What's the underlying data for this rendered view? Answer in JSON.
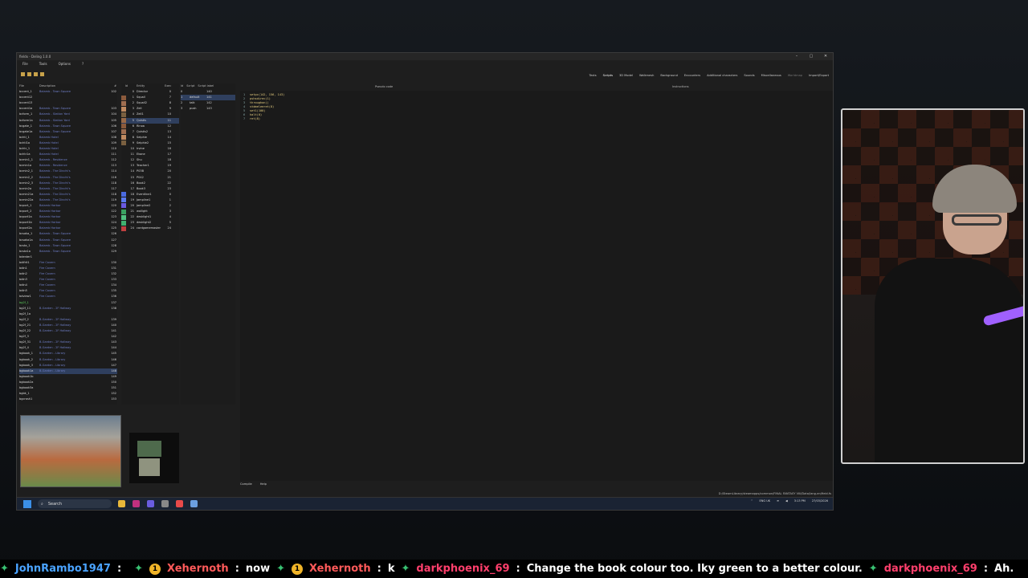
{
  "window": {
    "title": "fieldx - Deling 1.0.0",
    "controls": [
      "–",
      "▢",
      "✕"
    ]
  },
  "menu": [
    "File",
    "Tools",
    "Options",
    "?"
  ],
  "tabs": [
    {
      "label": "Texts"
    },
    {
      "label": "Scripts",
      "active": true
    },
    {
      "label": "3D Model"
    },
    {
      "label": "Walkmesh"
    },
    {
      "label": "Background"
    },
    {
      "label": "Encounters"
    },
    {
      "label": "Additional characters"
    },
    {
      "label": "Sounds"
    },
    {
      "label": "Miscellaneous"
    },
    {
      "label": "Worldmap",
      "dim": true
    },
    {
      "label": "Import/Export"
    }
  ],
  "file_list": {
    "headers": [
      "File",
      "Description",
      "#"
    ],
    "rows": [
      [
        "bccent_1",
        "Balamb - Town Square",
        "102"
      ],
      [
        "bccent12",
        "",
        ""
      ],
      [
        "bccent13",
        "",
        ""
      ],
      [
        "bccent1a",
        "Balamb - Town Square",
        "103"
      ],
      [
        "bcform_1",
        "Balamb - Station Yard",
        "104"
      ],
      [
        "bcform1a",
        "Balamb - Station Yard",
        "105"
      ],
      [
        "bcgate_1",
        "Balamb - Town Square",
        "106"
      ],
      [
        "bcgate1a",
        "Balamb - Town Square",
        "107"
      ],
      [
        "bchtl_1",
        "Balamb Hotel",
        "108"
      ],
      [
        "bchtl1a",
        "Balamb Hotel",
        "109"
      ],
      [
        "bchtr_1",
        "Balamb Hotel",
        "110"
      ],
      [
        "bchtr1a",
        "Balamb Hotel",
        "111"
      ],
      [
        "bcmin1_1",
        "Balamb - Residence",
        "112"
      ],
      [
        "bcmin1a",
        "Balamb - Residence",
        "113"
      ],
      [
        "bcmin2_1",
        "Balamb - The Dincht's",
        "114"
      ],
      [
        "bcmin2_2",
        "Balamb - The Dincht's",
        "116"
      ],
      [
        "bcmin2_3",
        "Balamb - The Dincht's",
        "118"
      ],
      [
        "bcmin2a",
        "Balamb - The Dincht's",
        "117"
      ],
      [
        "bcmin21a",
        "Balamb - The Dincht's",
        "118"
      ],
      [
        "bcmin22a",
        "Balamb - The Dincht's",
        "119"
      ],
      [
        "bcport_1",
        "Balamb Harbor",
        "120"
      ],
      [
        "bcport_2",
        "Balamb Harbor",
        "122"
      ],
      [
        "bcport1a",
        "Balamb Harbor",
        "123"
      ],
      [
        "bcport1b",
        "Balamb Harbor",
        "124"
      ],
      [
        "bcport2a",
        "Balamb Harbor",
        "125"
      ],
      [
        "bcsaka_1",
        "Balamb - Town Square",
        "126"
      ],
      [
        "bcsaka1a",
        "Balamb - Town Square",
        "127"
      ],
      [
        "bcsta_1",
        "Balamb - Town Square",
        "128"
      ],
      [
        "bcsta1a",
        "Balamb - Town Square",
        "129"
      ],
      [
        "bdenter1",
        "",
        ""
      ],
      [
        "bdifrit1",
        "Fire Cavern",
        "130"
      ],
      [
        "bdin1",
        "Fire Cavern",
        "131"
      ],
      [
        "bdin2",
        "Fire Cavern",
        "132"
      ],
      [
        "bdin3",
        "Fire Cavern",
        "133"
      ],
      [
        "bdin4",
        "Fire Cavern",
        "134"
      ],
      [
        "bdin5",
        "Fire Cavern",
        "135"
      ],
      [
        "bdview1",
        "Fire Cavern",
        "136"
      ],
      [
        "bg2f_1",
        "",
        "137"
      ],
      [
        "bg2f_11",
        "B-Garden - 2F Hallway",
        "138"
      ],
      [
        "bg2f_1a",
        "",
        ""
      ],
      [
        "bg2f_2",
        "B-Garden - 2F Hallway",
        "139"
      ],
      [
        "bg2f_21",
        "B-Garden - 2F Hallway",
        "140"
      ],
      [
        "bg2f_22",
        "B-Garden - 2F Hallway",
        "141"
      ],
      [
        "bg2f_3",
        "",
        "142"
      ],
      [
        "bg2f_31",
        "B-Garden - 2F Hallway",
        "143"
      ],
      [
        "bg2f_4",
        "B-Garden - 2F Hallway",
        "144"
      ],
      [
        "bgbook_1",
        "B-Garden - Library",
        "145"
      ],
      [
        "bgbook_2",
        "B-Garden - Library",
        "146"
      ],
      [
        "bgbook_3",
        "B-Garden - Library",
        "147"
      ],
      [
        "bgbook1a",
        "B-Garden - Library",
        "148"
      ],
      [
        "bgbook1b",
        "",
        "149"
      ],
      [
        "bgbook2a",
        "",
        "150"
      ],
      [
        "bgbook3a",
        "",
        "151"
      ],
      [
        "bgbk_1",
        "",
        "152"
      ],
      [
        "bgcrash1",
        "",
        "153"
      ]
    ]
  },
  "entities": {
    "headers": [
      "Id",
      "Entity",
      "Exec"
    ],
    "rows": [
      [
        "0",
        "Director",
        "0"
      ],
      [
        "1",
        "Squall",
        "7"
      ],
      [
        "2",
        "Squall2",
        "8"
      ],
      [
        "3",
        "Zell",
        "9"
      ],
      [
        "4",
        "Zell1",
        "10"
      ],
      [
        "5",
        "Quistis",
        "11"
      ],
      [
        "6",
        "Rinoa",
        "12"
      ],
      [
        "7",
        "Quistis2",
        "13"
      ],
      [
        "8",
        "Selphie",
        "14"
      ],
      [
        "9",
        "Selphie2",
        "15"
      ],
      [
        "10",
        "Irvine",
        "16"
      ],
      [
        "11",
        "Ekone",
        "17"
      ],
      [
        "12",
        "Shu",
        "18"
      ],
      [
        "13",
        "Teacher1",
        "19"
      ],
      [
        "14",
        "P03B",
        "20"
      ],
      [
        "15",
        "P042",
        "21"
      ],
      [
        "16",
        "Book2",
        "22"
      ],
      [
        "17",
        "Book3",
        "23"
      ],
      [
        "18",
        "Eventline1",
        "0"
      ],
      [
        "19",
        "Jampline1",
        "1"
      ],
      [
        "20",
        "Jampline2",
        "2"
      ],
      [
        "21",
        "wallight",
        "3"
      ],
      [
        "22",
        "desklight1",
        "4"
      ],
      [
        "23",
        "desklight2",
        "5"
      ],
      [
        "24",
        "cardgamemaster",
        "24"
      ]
    ]
  },
  "scripts": {
    "headers": [
      "Id",
      "Script",
      "Script label"
    ],
    "rows": [
      [
        "0",
        "",
        "140"
      ],
      [
        "1",
        "default",
        "141"
      ],
      [
        "2",
        "talk",
        "142"
      ],
      [
        "3",
        "push",
        "143"
      ]
    ]
  },
  "code": {
    "header": "Pseudo code",
    "instructions_header": "Instructions",
    "lines": [
      "setpc(142, 156, 143)",
      "pshsdirec(1)",
      "throughon()",
      "stdmeleeret(8)",
      "set1(100)",
      "halt(0)",
      "ret(8)"
    ]
  },
  "bottom": {
    "compile": "Compile",
    "help": "Help",
    "path": "D:/SteamLibrary/steamapps/common/FINAL FANTASY VIII/Data/lang-en/field.fs"
  },
  "taskbar": {
    "search": "Search",
    "lang": "ENG UK",
    "time": "3:13 PM",
    "date": "27/03/2026"
  },
  "ticker": {
    "items": [
      {
        "user": "JohnRambo1947",
        "msg": ""
      },
      {
        "user": "Xehernoth",
        "msg": "now"
      },
      {
        "user": "Xehernoth",
        "msg": "k"
      },
      {
        "user": "darkphoenix_69",
        "msg": "Change the book colour too. Iky green to a better colour."
      },
      {
        "user": "darkphoenix_69",
        "msg": "Ah."
      }
    ]
  },
  "colors": {
    "accent_tab": "#ffffff",
    "selection": "#2f3f5e",
    "description_text": "#6f7fc8",
    "code_text": "#e8d080"
  }
}
